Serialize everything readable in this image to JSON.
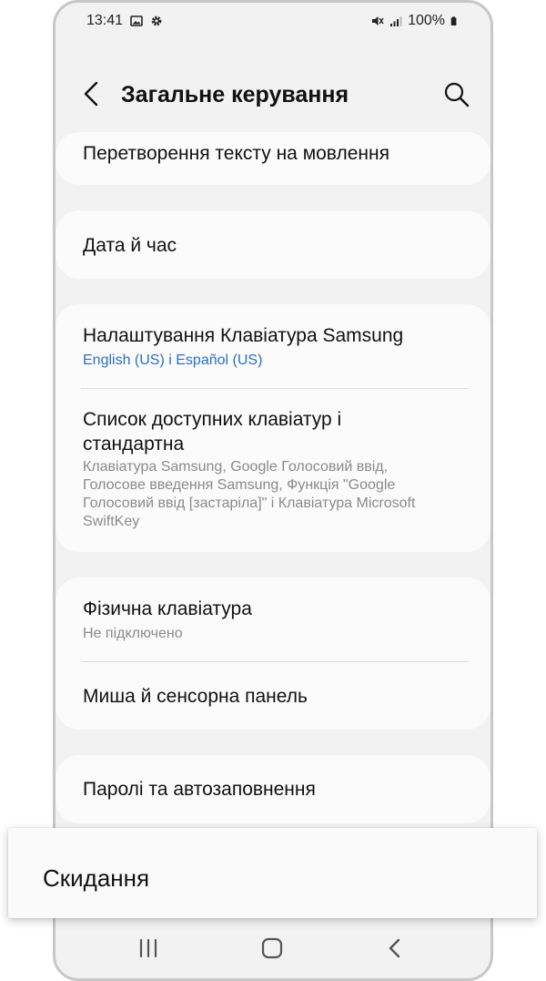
{
  "status_bar": {
    "time": "13:41",
    "battery": "100%",
    "left_icons": [
      "image-icon",
      "gear-icon"
    ],
    "right_icons": [
      "mute-icon",
      "signal-icon",
      "battery-icon"
    ]
  },
  "header": {
    "title": "Загальне керування",
    "back_icon": "chevron-left-icon",
    "search_icon": "search-icon"
  },
  "settings": {
    "tts": {
      "label": "Перетворення тексту на мовлення"
    },
    "date_time": {
      "label": "Дата й час"
    },
    "samsung_keyboard": {
      "label": "Налаштування Клавіатура Samsung",
      "sub": "English (US) і Español (US)"
    },
    "keyboard_list": {
      "label_line1": "Список доступних клавіатур і",
      "label_line2": "стандартна",
      "sub_line1": "Клавіатура Samsung, Google Голосовий ввід,",
      "sub_line2": "Голосове введення Samsung, Функція \"Google",
      "sub_line3": "Голосовий ввід [застаріла]\" і Клавіатура Microsoft",
      "sub_line4": "SwiftKey"
    },
    "physical_keyboard": {
      "label": "Фізична клавіатура",
      "sub": "Не підключено"
    },
    "mouse_touchpad": {
      "label": "Миша й сенсорна панель"
    },
    "passwords": {
      "label": "Паролі та автозаповнення"
    }
  },
  "overlay": {
    "label": "Скидання"
  },
  "nav_bar": {
    "icons": [
      "recents-icon",
      "home-icon",
      "back-icon"
    ]
  },
  "colors": {
    "accent_blue": "#2a6fc5",
    "background": "#f2f2f2",
    "card": "#fbfbfb"
  }
}
